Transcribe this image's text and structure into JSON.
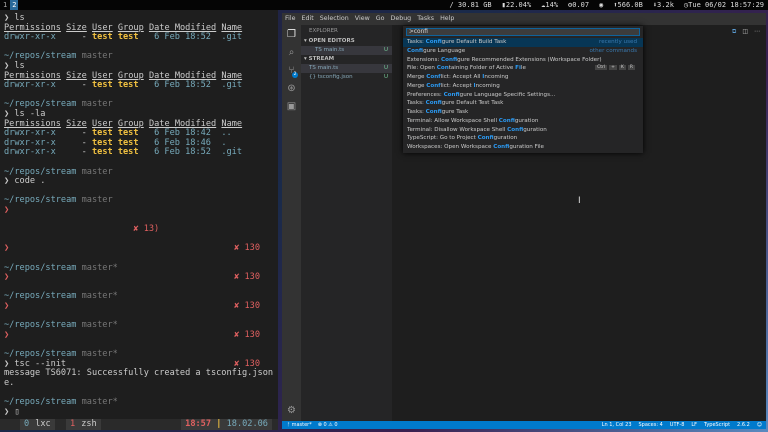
{
  "topbar": {
    "workspaces": [
      "1",
      "2"
    ],
    "active_workspace": "2",
    "stats": [
      "/ 30.81 GB",
      "▮22.04%",
      "☁14%",
      "⚙0.07",
      "◉",
      "⬆566.0B",
      "⬇3.2k",
      "◷Tue 06/02 18:57:29"
    ]
  },
  "terminal": {
    "lines": [
      [
        {
          "t": "❯ ls"
        }
      ],
      [
        {
          "t": "Permissions",
          "c": "u"
        },
        {
          "t": " "
        },
        {
          "t": "Size",
          "c": "u"
        },
        {
          "t": " "
        },
        {
          "t": "User",
          "c": "u"
        },
        {
          "t": " "
        },
        {
          "t": "Group",
          "c": "u"
        },
        {
          "t": " "
        },
        {
          "t": "Date Modified",
          "c": "u"
        },
        {
          "t": " "
        },
        {
          "t": "Name",
          "c": "u"
        }
      ],
      [
        {
          "t": "drwxr-xr-x",
          "c": "b"
        },
        {
          "t": "     - "
        },
        {
          "t": "test test",
          "c": "y"
        },
        {
          "t": "   6 Feb 18:52",
          "c": "b"
        },
        {
          "t": "  .git",
          "c": "b"
        }
      ],
      [],
      [
        {
          "t": "~/repos/stream",
          "c": "b"
        },
        {
          "t": " master",
          "c": "g"
        }
      ],
      [
        {
          "t": "❯ ls"
        }
      ],
      [
        {
          "t": "Permissions",
          "c": "u"
        },
        {
          "t": " "
        },
        {
          "t": "Size",
          "c": "u"
        },
        {
          "t": " "
        },
        {
          "t": "User",
          "c": "u"
        },
        {
          "t": " "
        },
        {
          "t": "Group",
          "c": "u"
        },
        {
          "t": " "
        },
        {
          "t": "Date Modified",
          "c": "u"
        },
        {
          "t": " "
        },
        {
          "t": "Name",
          "c": "u"
        }
      ],
      [
        {
          "t": "drwxr-xr-x",
          "c": "b"
        },
        {
          "t": "     - "
        },
        {
          "t": "test test",
          "c": "y"
        },
        {
          "t": "   6 Feb 18:52",
          "c": "b"
        },
        {
          "t": "  .git",
          "c": "b"
        }
      ],
      [],
      [
        {
          "t": "~/repos/stream",
          "c": "b"
        },
        {
          "t": " master",
          "c": "g"
        }
      ],
      [
        {
          "t": "❯ ls -la"
        }
      ],
      [
        {
          "t": "Permissions",
          "c": "u"
        },
        {
          "t": " "
        },
        {
          "t": "Size",
          "c": "u"
        },
        {
          "t": " "
        },
        {
          "t": "User",
          "c": "u"
        },
        {
          "t": " "
        },
        {
          "t": "Group",
          "c": "u"
        },
        {
          "t": " "
        },
        {
          "t": "Date Modified",
          "c": "u"
        },
        {
          "t": " "
        },
        {
          "t": "Name",
          "c": "u"
        }
      ],
      [
        {
          "t": "drwxr-xr-x",
          "c": "b"
        },
        {
          "t": "     - "
        },
        {
          "t": "test test",
          "c": "y"
        },
        {
          "t": "   6 Feb 18:42",
          "c": "b"
        },
        {
          "t": "  ..",
          "c": "b"
        }
      ],
      [
        {
          "t": "drwxr-xr-x",
          "c": "b"
        },
        {
          "t": "     - "
        },
        {
          "t": "test test",
          "c": "y"
        },
        {
          "t": "   6 Feb 18:46",
          "c": "b"
        },
        {
          "t": "  .",
          "c": "b"
        }
      ],
      [
        {
          "t": "drwxr-xr-x",
          "c": "b"
        },
        {
          "t": "     - "
        },
        {
          "t": "test test",
          "c": "y"
        },
        {
          "t": "   6 Feb 18:52",
          "c": "b"
        },
        {
          "t": "  .git",
          "c": "b"
        }
      ],
      [],
      [
        {
          "t": "~/repos/stream",
          "c": "b"
        },
        {
          "t": " master",
          "c": "g"
        }
      ],
      [
        {
          "t": "❯ code ."
        }
      ],
      [],
      [
        {
          "t": "~/repos/stream",
          "c": "b"
        },
        {
          "t": " master",
          "c": "g"
        }
      ],
      [
        {
          "t": "❯",
          "c": "r"
        }
      ],
      [],
      [
        {
          "t": "                         ✘ 13)",
          "c": "r"
        }
      ],
      [],
      [
        {
          "t": "❯",
          "c": "r"
        },
        {
          "t": "✘ 130",
          "c": "r rt"
        }
      ],
      [],
      [
        {
          "t": "~/repos/stream",
          "c": "b"
        },
        {
          "t": " master*",
          "c": "g"
        }
      ],
      [
        {
          "t": "❯",
          "c": "r"
        },
        {
          "t": "✘ 130",
          "c": "r rt"
        }
      ],
      [],
      [
        {
          "t": "~/repos/stream",
          "c": "b"
        },
        {
          "t": " master*",
          "c": "g"
        }
      ],
      [
        {
          "t": "❯",
          "c": "r"
        },
        {
          "t": "✘ 130",
          "c": "r rt"
        }
      ],
      [],
      [
        {
          "t": "~/repos/stream",
          "c": "b"
        },
        {
          "t": " master*",
          "c": "g"
        }
      ],
      [
        {
          "t": "❯",
          "c": "r"
        },
        {
          "t": "✘ 130",
          "c": "r rt"
        }
      ],
      [],
      [
        {
          "t": "~/repos/stream",
          "c": "b"
        },
        {
          "t": " master*",
          "c": "g"
        }
      ],
      [
        {
          "t": "❯ tsc --init"
        },
        {
          "t": "✘ 130",
          "c": "r rt"
        }
      ],
      [
        {
          "t": "message TS6071: Successfully created a tsconfig.json fil"
        }
      ],
      [
        {
          "t": "e."
        }
      ],
      [],
      [
        {
          "t": "~/repos/stream",
          "c": "b"
        },
        {
          "t": " master*",
          "c": "g"
        }
      ],
      [
        {
          "t": "❯ ▯"
        }
      ]
    ],
    "tmux": {
      "win0_index": "0",
      "win0_name": "lxc",
      "win1_index": "1",
      "win1_name": "zsh",
      "time": "18:57",
      "date": "18.02.06"
    }
  },
  "vscode": {
    "menu": [
      "File",
      "Edit",
      "Selection",
      "View",
      "Go",
      "Debug",
      "Tasks",
      "Help"
    ],
    "sidebar": {
      "title": "EXPLORER",
      "open_editors": "▾ OPEN EDITORS",
      "open_file": "TS main.ts",
      "open_file_mark": "U",
      "section": "▾ STREAM",
      "files": [
        {
          "name": "TS main.ts",
          "mark": "U"
        },
        {
          "name": "{} tsconfig.json",
          "mark": "U"
        }
      ],
      "scm_badge": "2"
    },
    "palette": {
      "input": ">confi",
      "items": [
        {
          "parts": [
            [
              "Tasks: ",
              0
            ],
            [
              "Confi",
              1
            ],
            [
              "gure Default Build Task",
              0
            ]
          ],
          "hint": "recently used"
        },
        {
          "parts": [
            [
              "Confi",
              1
            ],
            [
              "gure Language",
              0
            ]
          ],
          "hint": "other commands"
        },
        {
          "parts": [
            [
              "Extensions: ",
              0
            ],
            [
              "Confi",
              1
            ],
            [
              "gure Recommended Extensions (Workspace Folder)",
              0
            ]
          ]
        },
        {
          "parts": [
            [
              "File: Open ",
              0
            ],
            [
              "Con",
              1
            ],
            [
              "taining Folder of Active ",
              0
            ],
            [
              "Fi",
              1
            ],
            [
              "le",
              0
            ]
          ],
          "keys": [
            "Ctrl",
            "+",
            "K",
            "R"
          ]
        },
        {
          "parts": [
            [
              "Merge ",
              0
            ],
            [
              "Conf",
              1
            ],
            [
              "lict: Accept All ",
              0
            ],
            [
              "I",
              1
            ],
            [
              "ncoming",
              0
            ]
          ]
        },
        {
          "parts": [
            [
              "Merge ",
              0
            ],
            [
              "Conf",
              1
            ],
            [
              "lict: Accept ",
              0
            ],
            [
              "I",
              1
            ],
            [
              "ncoming",
              0
            ]
          ]
        },
        {
          "parts": [
            [
              "Preferences: ",
              0
            ],
            [
              "Confi",
              1
            ],
            [
              "gure Language Specific Settings...",
              0
            ]
          ]
        },
        {
          "parts": [
            [
              "Tasks: ",
              0
            ],
            [
              "Confi",
              1
            ],
            [
              "gure Default Test Task",
              0
            ]
          ]
        },
        {
          "parts": [
            [
              "Tasks: ",
              0
            ],
            [
              "Confi",
              1
            ],
            [
              "gure Task",
              0
            ]
          ]
        },
        {
          "parts": [
            [
              "Terminal: Allow Workspace Shell ",
              0
            ],
            [
              "Confi",
              1
            ],
            [
              "guration",
              0
            ]
          ]
        },
        {
          "parts": [
            [
              "Terminal: Disallow Workspace Shell ",
              0
            ],
            [
              "Confi",
              1
            ],
            [
              "guration",
              0
            ]
          ]
        },
        {
          "parts": [
            [
              "TypeScript: Go to Project ",
              0
            ],
            [
              "Confi",
              1
            ],
            [
              "guration",
              0
            ]
          ]
        },
        {
          "parts": [
            [
              "Workspaces: Open Workspace ",
              0
            ],
            [
              "Confi",
              1
            ],
            [
              "guration File",
              0
            ]
          ]
        }
      ]
    },
    "status": {
      "branch": "ᚠ master*",
      "problems": "⊗ 0 ⚠ 0",
      "position": "Ln 1, Col 23",
      "spaces": "Spaces: 4",
      "encoding": "UTF-8",
      "eol": "LF",
      "language": "TypeScript",
      "version": "2.6.2",
      "smiley": "☺"
    }
  }
}
